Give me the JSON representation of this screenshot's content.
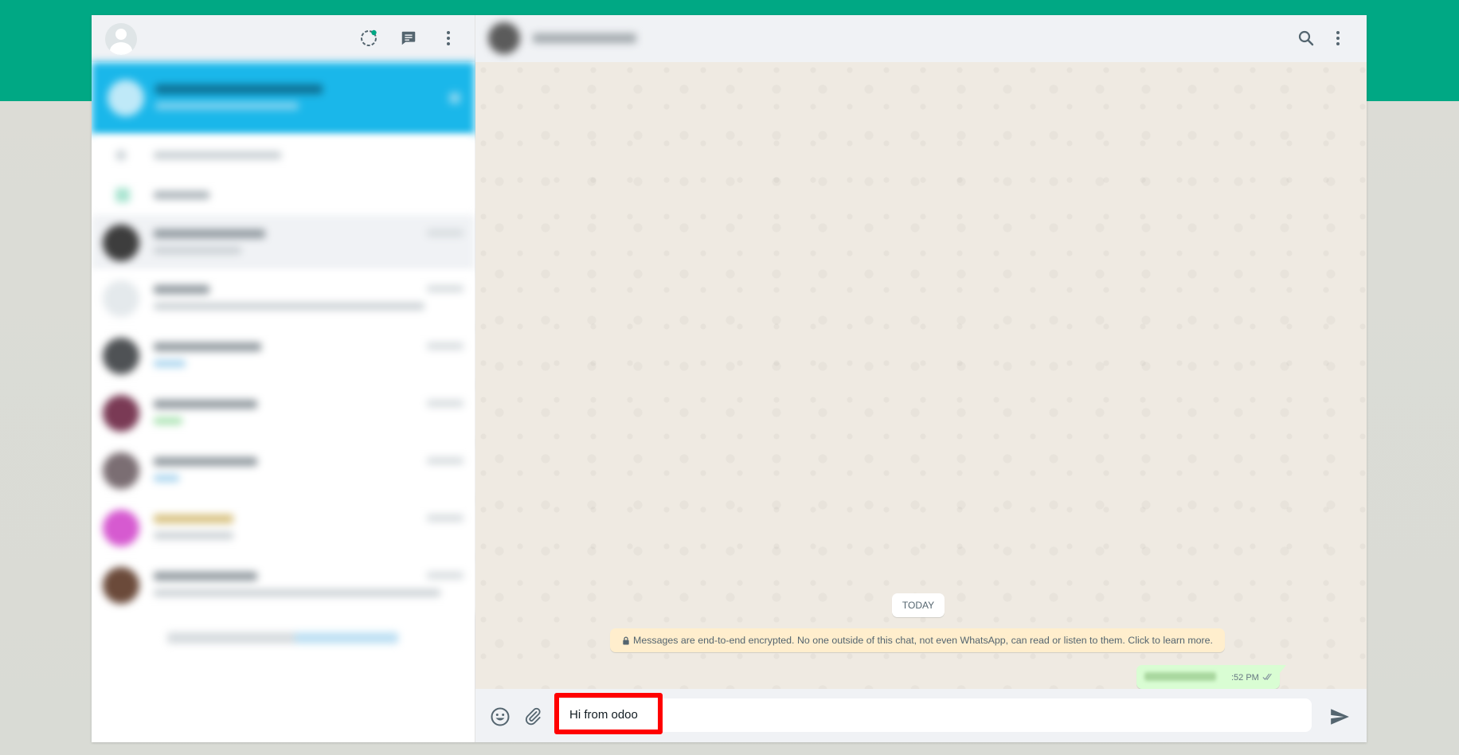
{
  "header": {
    "icons": [
      "status-icon",
      "new-chat-icon",
      "menu-icon"
    ]
  },
  "conversation": {
    "header_icons": [
      "search-icon",
      "menu-icon"
    ],
    "date_divider": "TODAY",
    "encryption_notice": "Messages are end-to-end encrypted. No one outside of this chat, not even WhatsApp, can read or listen to them. Click to learn more.",
    "outgoing_message": {
      "time": ":52 PM",
      "status_icon": "double-check-icon"
    }
  },
  "composer": {
    "value": "Hi from odoo",
    "icons": [
      "emoji-icon",
      "attach-icon",
      "send-icon"
    ]
  },
  "colors": {
    "accent": "#00a884",
    "notification_bar": "#1ab7ea",
    "highlight": "#ff0000",
    "chat_background": "#efeae2"
  }
}
